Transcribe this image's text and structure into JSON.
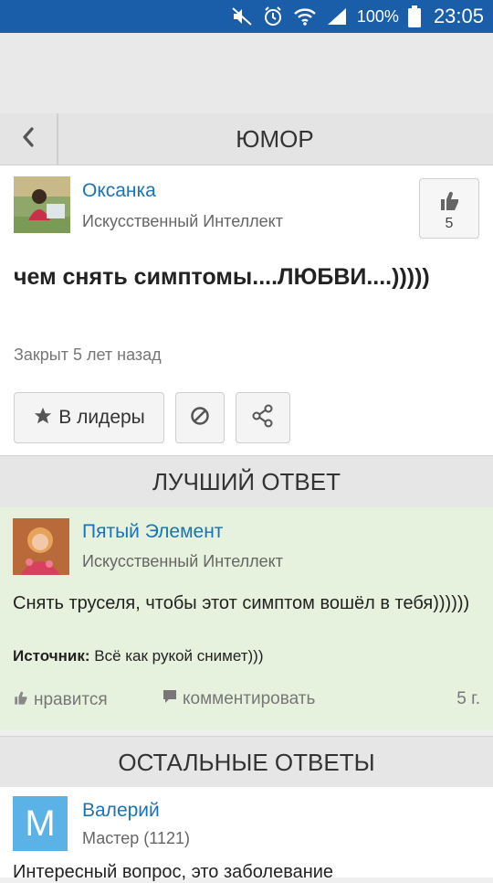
{
  "status_bar": {
    "battery_percent": "100%",
    "time": "23:05"
  },
  "nav": {
    "title": "ЮМОР"
  },
  "question": {
    "author_name": "Оксанка",
    "author_rank": "Искусственный Интеллект",
    "likes": "5",
    "title": "чем снять симптомы....ЛЮБВИ....)))))",
    "status": "Закрыт 5 лет назад",
    "leaders_button": "В лидеры"
  },
  "best_answer": {
    "header": "ЛУЧШИЙ ОТВЕТ",
    "author_name": "Пятый Элемент",
    "author_rank": "Искусственный Интеллект",
    "text": "Снять труселя, чтобы этот симптом вошёл в тебя))))))",
    "source_label": "Источник:",
    "source_text": "Всё как рукой снимет)))",
    "like_label": "нравится",
    "comment_label": "комментировать",
    "age": "5 г."
  },
  "other_answers": {
    "header": "ОСТАЛЬНЫЕ ОТВЕТЫ",
    "first": {
      "avatar_letter": "M",
      "author_name": "Валерий",
      "author_rank": "Мастер (1121)",
      "text_partial": "Интересный вопрос, это заболевание"
    }
  },
  "colors": {
    "status_bar": "#1a5da8",
    "link": "#1a73b8",
    "best_bg": "#e6f2dd",
    "avatar_m": "#5ab2e6"
  }
}
